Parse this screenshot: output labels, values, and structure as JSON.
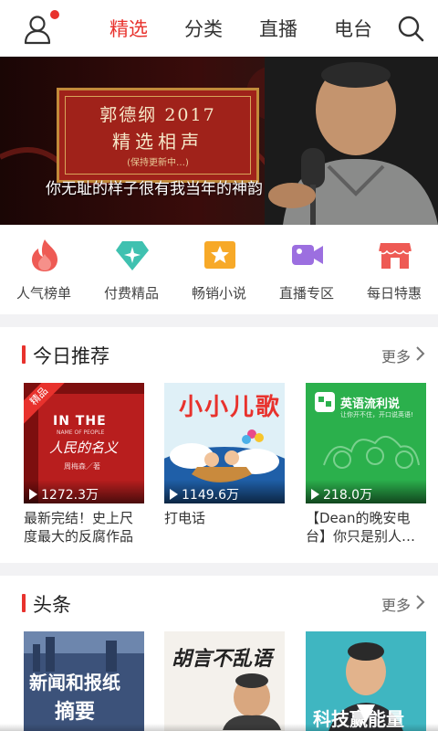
{
  "header": {
    "tabs": [
      {
        "label": "精选",
        "active": true
      },
      {
        "label": "分类",
        "active": false
      },
      {
        "label": "直播",
        "active": false
      },
      {
        "label": "电台",
        "active": false
      }
    ],
    "user_icon": "user-icon",
    "search_icon": "search-icon",
    "accent": "#e8322d"
  },
  "banner": {
    "title_line1": "郭德纲 2017",
    "title_line2": "精选相声",
    "subtitle": "(保持更新中…)",
    "caption": "你无耻的样子很有我当年的神韵"
  },
  "quick_entries": [
    {
      "label": "人气榜单",
      "icon": "flame-icon",
      "color": "#ee5a54"
    },
    {
      "label": "付费精品",
      "icon": "diamond-icon",
      "color": "#3fc1b0"
    },
    {
      "label": "畅销小说",
      "icon": "star-book-icon",
      "color": "#f7a928"
    },
    {
      "label": "直播专区",
      "icon": "video-camera-icon",
      "color": "#9c6fe0"
    },
    {
      "label": "每日特惠",
      "icon": "shop-icon",
      "color": "#ee5a54"
    }
  ],
  "today": {
    "title": "今日推荐",
    "more": "更多",
    "cards": [
      {
        "title": "最新完结！史上尺度最大的反腐作品",
        "plays": "1272.3万",
        "badge": "精品",
        "cover_text_en": "IN THE",
        "cover_text_en_sub": "NAME OF PEOPLE",
        "cover_text_cn": "人民的名义",
        "cover_author": "周梅森／著"
      },
      {
        "title": "打电话",
        "plays": "1149.6万",
        "cover_text": "小小儿歌"
      },
      {
        "title": "【Dean的晚安电台】你只是别人…",
        "plays": "218.0万",
        "cover_text": "英语流利说",
        "cover_sub": "让你开不住，开口说英语!"
      }
    ]
  },
  "news": {
    "title": "头条",
    "more": "更多",
    "cards": [
      {
        "cover_text_line1": "新闻和报纸",
        "cover_text_line2": "摘要"
      },
      {
        "cover_text": "胡言不乱语"
      },
      {
        "cover_text": "科技赢能量"
      }
    ]
  }
}
